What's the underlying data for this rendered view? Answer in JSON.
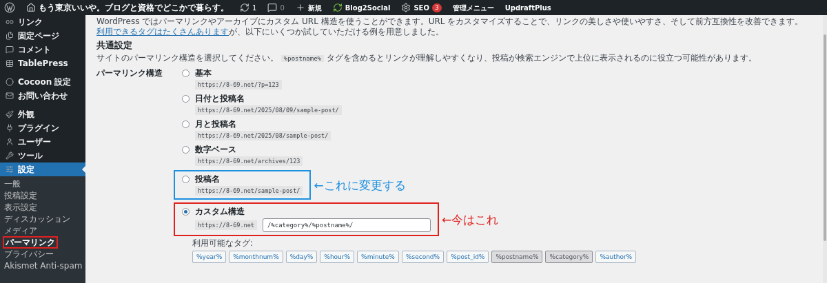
{
  "admin_bar": {
    "site_title": "もう東京いいや。ブログと資格でどこかで暮らす。",
    "updates": "1",
    "comments": "0",
    "new": "新規",
    "items": [
      {
        "kind": "b2s",
        "label": "Blog2Social"
      },
      {
        "kind": "seo",
        "label": "SEO",
        "badge": "3"
      },
      {
        "kind": "plain",
        "label": "管理メニュー"
      },
      {
        "kind": "plain",
        "label": "UpdraftPlus"
      }
    ]
  },
  "sidebar": {
    "items": [
      {
        "label": "リンク",
        "selected": false
      },
      {
        "label": "固定ページ",
        "selected": false
      },
      {
        "label": "コメント",
        "selected": false
      },
      {
        "label": "TablePress",
        "selected": false
      },
      {
        "label": "Cocoon 設定",
        "selected": false
      },
      {
        "label": "お問い合わせ",
        "selected": false
      },
      {
        "label": "外観",
        "selected": false
      },
      {
        "label": "プラグイン",
        "selected": false
      },
      {
        "label": "ユーザー",
        "selected": false
      },
      {
        "label": "ツール",
        "selected": false
      },
      {
        "label": "設定",
        "selected": true
      }
    ],
    "submenu": [
      {
        "label": "一般",
        "selected": false
      },
      {
        "label": "投稿設定",
        "selected": false
      },
      {
        "label": "表示設定",
        "selected": false
      },
      {
        "label": "ディスカッション",
        "selected": false
      },
      {
        "label": "メディア",
        "selected": false
      },
      {
        "label": "パーマリンク",
        "selected": true
      },
      {
        "label": "プライバシー",
        "selected": false
      },
      {
        "label": "Akismet Anti-spam",
        "selected": false
      }
    ]
  },
  "intro": {
    "before": "WordPress ではパーマリンクやアーカイブにカスタム URL 構造を使うことができます。URL をカスタマイズすることで、リンクの美しさや使いやすさ、そして前方互換性を改善できます。",
    "link": "利用できるタグはたくさんあります",
    "after": "が、以下にいくつか試していただける例を用意しました。"
  },
  "section_title": "共通設定",
  "description": {
    "before": "サイトのパーマリンク構造を選択してください。",
    "code": "%postname%",
    "after": "タグを含めるとリンクが理解しやすくなり、投稿が検索エンジンで上位に表示されるのに役立つ可能性があります。"
  },
  "field_label": "パーマリンク構造",
  "options": [
    {
      "label": "基本",
      "example": "https://8-69.net/?p=123",
      "selected": false
    },
    {
      "label": "日付と投稿名",
      "example": "https://8-69.net/2025/08/09/sample-post/",
      "selected": false
    },
    {
      "label": "月と投稿名",
      "example": "https://8-69.net/2025/08/sample-post/",
      "selected": false
    },
    {
      "label": "数字ベース",
      "example": "https://8-69.net/archives/123",
      "selected": false
    },
    {
      "label": "投稿名",
      "example": "https://8-69.net/sample-post/",
      "selected": false,
      "annotation": {
        "text": "←これに変更する",
        "color": "#1e90e0"
      }
    },
    {
      "label": "カスタム構造",
      "prefix": "https://8-69.net",
      "value": "/%category%/%postname%/",
      "selected": true,
      "annotation": {
        "text": "←今はこれ",
        "color": "#e0201c"
      }
    }
  ],
  "tags_label": "利用可能なタグ:",
  "tags": [
    {
      "label": "%year%",
      "selected": false
    },
    {
      "label": "%monthnum%",
      "selected": false
    },
    {
      "label": "%day%",
      "selected": false
    },
    {
      "label": "%hour%",
      "selected": false
    },
    {
      "label": "%minute%",
      "selected": false
    },
    {
      "label": "%second%",
      "selected": false
    },
    {
      "label": "%post_id%",
      "selected": false
    },
    {
      "label": "%postname%",
      "selected": true
    },
    {
      "label": "%category%",
      "selected": true
    },
    {
      "label": "%author%",
      "selected": false
    }
  ]
}
